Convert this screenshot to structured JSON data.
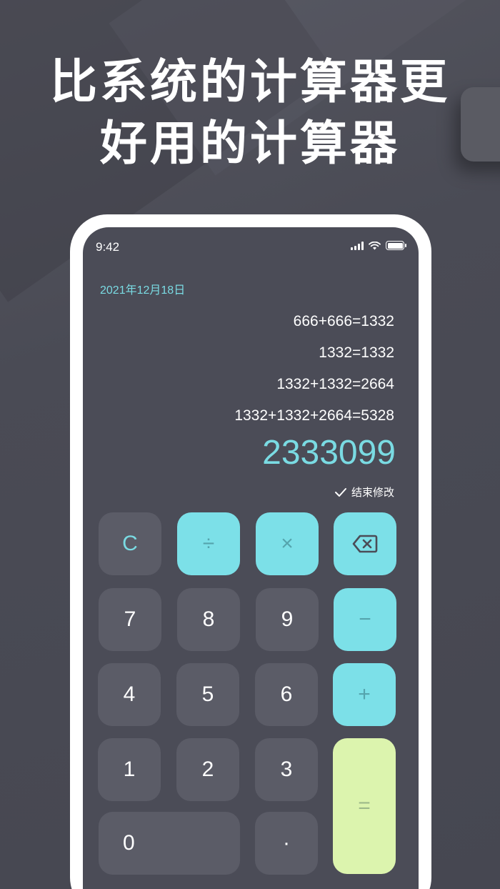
{
  "headline": {
    "line1": "比系统的计算器更",
    "line2": "好用的计算器"
  },
  "status_bar": {
    "time": "9:42"
  },
  "date": "2021年12月18日",
  "history": [
    "666+666=1332",
    "1332=1332",
    "1332+1332=2664",
    "1332+1332+2664=5328"
  ],
  "result": "2333099",
  "finish_edit": "结束修改",
  "keys": {
    "clear": "C",
    "divide": "÷",
    "multiply": "×",
    "seven": "7",
    "eight": "8",
    "nine": "9",
    "minus": "−",
    "four": "4",
    "five": "5",
    "six": "6",
    "plus": "+",
    "one": "1",
    "two": "2",
    "three": "3",
    "equals": "=",
    "zero": "0",
    "dot": "·"
  },
  "colors": {
    "accent": "#7adbe3",
    "operator_key": "#7ce0e8",
    "equals_key": "#dcf4ae",
    "number_key": "#5b5c67",
    "screen_bg": "#4b4c57"
  }
}
